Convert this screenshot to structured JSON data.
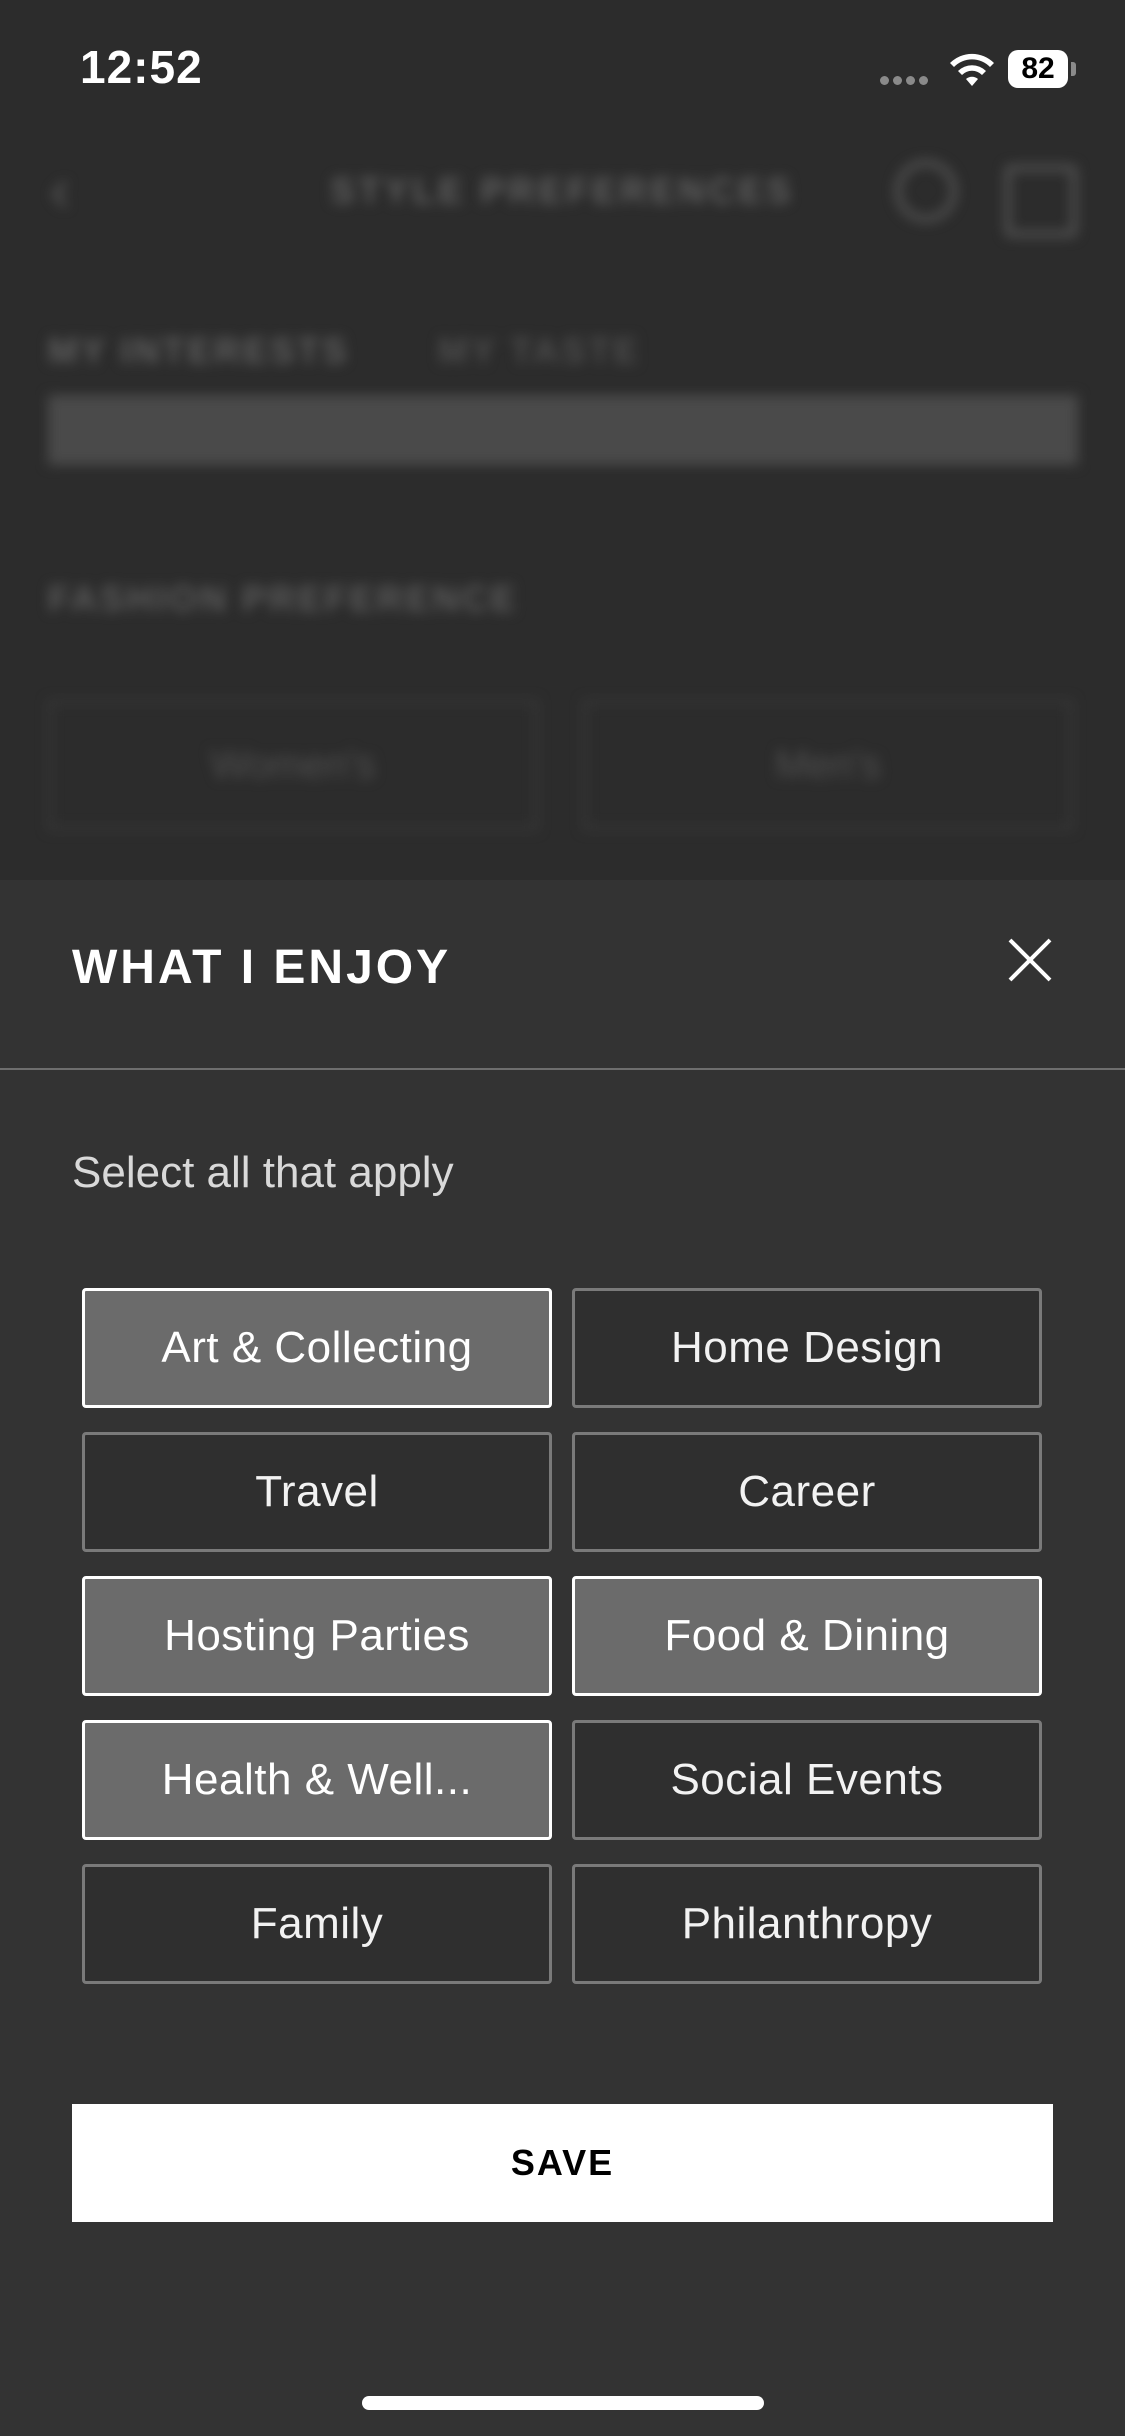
{
  "status_bar": {
    "time": "12:52",
    "battery": "82"
  },
  "background": {
    "title": "STYLE PREFERENCES",
    "tabs": [
      "MY INTERESTS",
      "MY TASTE"
    ],
    "section": "FASHION PREFERENCE",
    "buttons": [
      "Women's",
      "Men's"
    ]
  },
  "sheet": {
    "title": "WHAT I ENJOY",
    "subtitle": "Select all that apply",
    "options": [
      {
        "label": "Art & Collecting",
        "selected": true
      },
      {
        "label": "Home Design",
        "selected": false
      },
      {
        "label": "Travel",
        "selected": false
      },
      {
        "label": "Career",
        "selected": false
      },
      {
        "label": "Hosting Parties",
        "selected": true
      },
      {
        "label": "Food & Dining",
        "selected": true
      },
      {
        "label": "Health & Well...",
        "selected": true
      },
      {
        "label": "Social Events",
        "selected": false
      },
      {
        "label": "Family",
        "selected": false
      },
      {
        "label": "Philanthropy",
        "selected": false
      }
    ],
    "save_label": "SAVE"
  },
  "icons": {
    "close": "close-icon",
    "back": "back-arrow-icon",
    "search": "search-icon",
    "bag": "shopping-bag-icon",
    "wifi": "wifi-icon",
    "battery": "battery-icon"
  }
}
